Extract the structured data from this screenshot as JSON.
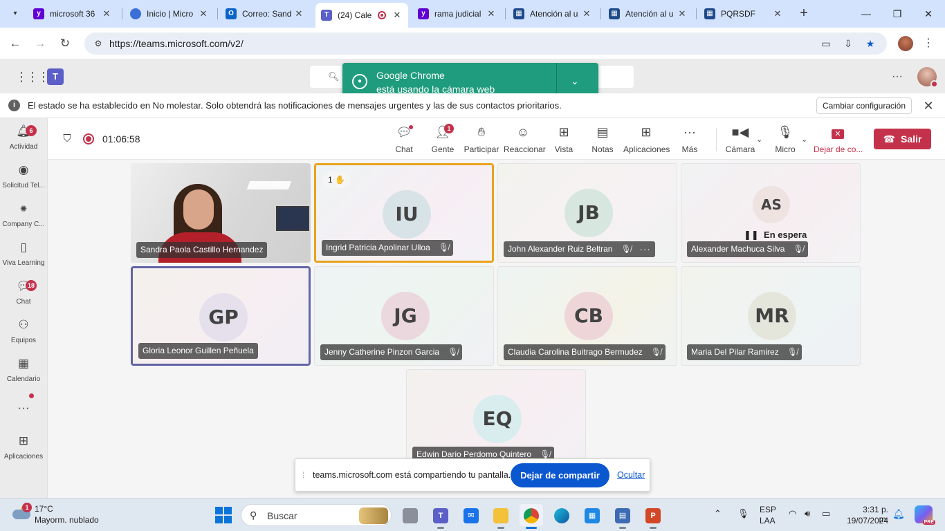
{
  "browser": {
    "tabs": [
      {
        "title": "microsoft 36",
        "favicon": "yahoo",
        "color": "#6001d2"
      },
      {
        "title": "Inicio | Micro",
        "favicon": "microsoft-365",
        "color": "#3a6fd8"
      },
      {
        "title": "Correo: Sand",
        "favicon": "outlook",
        "color": "#0a64c7"
      },
      {
        "title": "(24) Cale",
        "favicon": "teams",
        "color": "#5b5fc7",
        "active": true,
        "recording": true
      },
      {
        "title": "rama judicial",
        "favicon": "yahoo",
        "color": "#6001d2"
      },
      {
        "title": "Atención al u",
        "favicon": "forms",
        "color": "#1e4a8a"
      },
      {
        "title": "Atención al u",
        "favicon": "forms",
        "color": "#1e4a8a"
      },
      {
        "title": "PQRSDF",
        "favicon": "forms",
        "color": "#1e4a8a"
      }
    ],
    "url": "https://teams.microsoft.com/v2/"
  },
  "camera_popup": {
    "line1": "Google Chrome",
    "line2": "está usando la cámara web"
  },
  "notification": {
    "text": "El estado se ha establecido en No molestar. Solo obtendrá las notificaciones de mensajes urgentes y las de sus contactos prioritarios.",
    "button": "Cambiar configuración"
  },
  "rail": [
    {
      "label": "Actividad",
      "icon": "bell-icon",
      "badge": "6"
    },
    {
      "label": "Solicitud Tel...",
      "icon": "app-icon",
      "badge": ""
    },
    {
      "label": "Company C...",
      "icon": "app-icon",
      "badge": ""
    },
    {
      "label": "Viva Learning",
      "icon": "book-icon",
      "badge": ""
    },
    {
      "label": "Chat",
      "icon": "chat-icon",
      "badge": "18"
    },
    {
      "label": "Equipos",
      "icon": "teams-icon",
      "badge": ""
    },
    {
      "label": "Calendario",
      "icon": "calendar-icon",
      "badge": ""
    },
    {
      "label": "",
      "icon": "more-icon",
      "badge": ""
    },
    {
      "label": "Aplicaciones",
      "icon": "plus-icon",
      "badge": ""
    }
  ],
  "meeting": {
    "timer": "01:06:58",
    "toolbar": [
      {
        "label": "Chat",
        "icon": "chat-icon"
      },
      {
        "label": "Gente",
        "icon": "people-icon",
        "badge": "1"
      },
      {
        "label": "Participar",
        "icon": "raise-hand-icon"
      },
      {
        "label": "Reaccionar",
        "icon": "smile-icon"
      },
      {
        "label": "Vista",
        "icon": "grid-icon"
      },
      {
        "label": "Notas",
        "icon": "notes-icon"
      },
      {
        "label": "Aplicaciones",
        "icon": "plus-icon"
      },
      {
        "label": "Más",
        "icon": "more-icon"
      },
      {
        "label": "Cámara",
        "icon": "camera-icon"
      },
      {
        "label": "Micro",
        "icon": "microphone-icon"
      },
      {
        "label": "Dejar de co...",
        "icon": "stop-share-icon"
      }
    ],
    "leave": "Salir",
    "participants": [
      {
        "name": "Sandra Paola Castillo Hernandez",
        "initials": "",
        "video": true
      },
      {
        "name": "Ingrid Patricia Apolinar Ulloa",
        "initials": "IU",
        "hand": "1"
      },
      {
        "name": "John Alexander Ruiz Beltran",
        "initials": "JB"
      },
      {
        "name": "Alexander Machuca Silva",
        "initials": "AS",
        "status": "En espera"
      },
      {
        "name": "Gloria Leonor Guillen Peñuela",
        "initials": "GP"
      },
      {
        "name": "Jenny Catherine Pinzon Garcia",
        "initials": "JG"
      },
      {
        "name": "Claudia Carolina Buitrago Bermudez",
        "initials": "CB"
      },
      {
        "name": "Maria Del Pilar Ramirez",
        "initials": "MR"
      },
      {
        "name": "Edwin Dario Perdomo Quintero",
        "initials": "EQ"
      }
    ]
  },
  "share_banner": {
    "text": "teams.microsoft.com está compartiendo tu pantalla.",
    "stop": "Dejar de compartir",
    "hide": "Ocultar"
  },
  "taskbar": {
    "weather_temp": "17°C",
    "weather_desc": "Mayorm. nublado",
    "weather_badge": "1",
    "search": "Buscar",
    "lang1": "ESP",
    "lang2": "LAA",
    "time": "3:31 p. m.",
    "date": "19/07/2024"
  }
}
